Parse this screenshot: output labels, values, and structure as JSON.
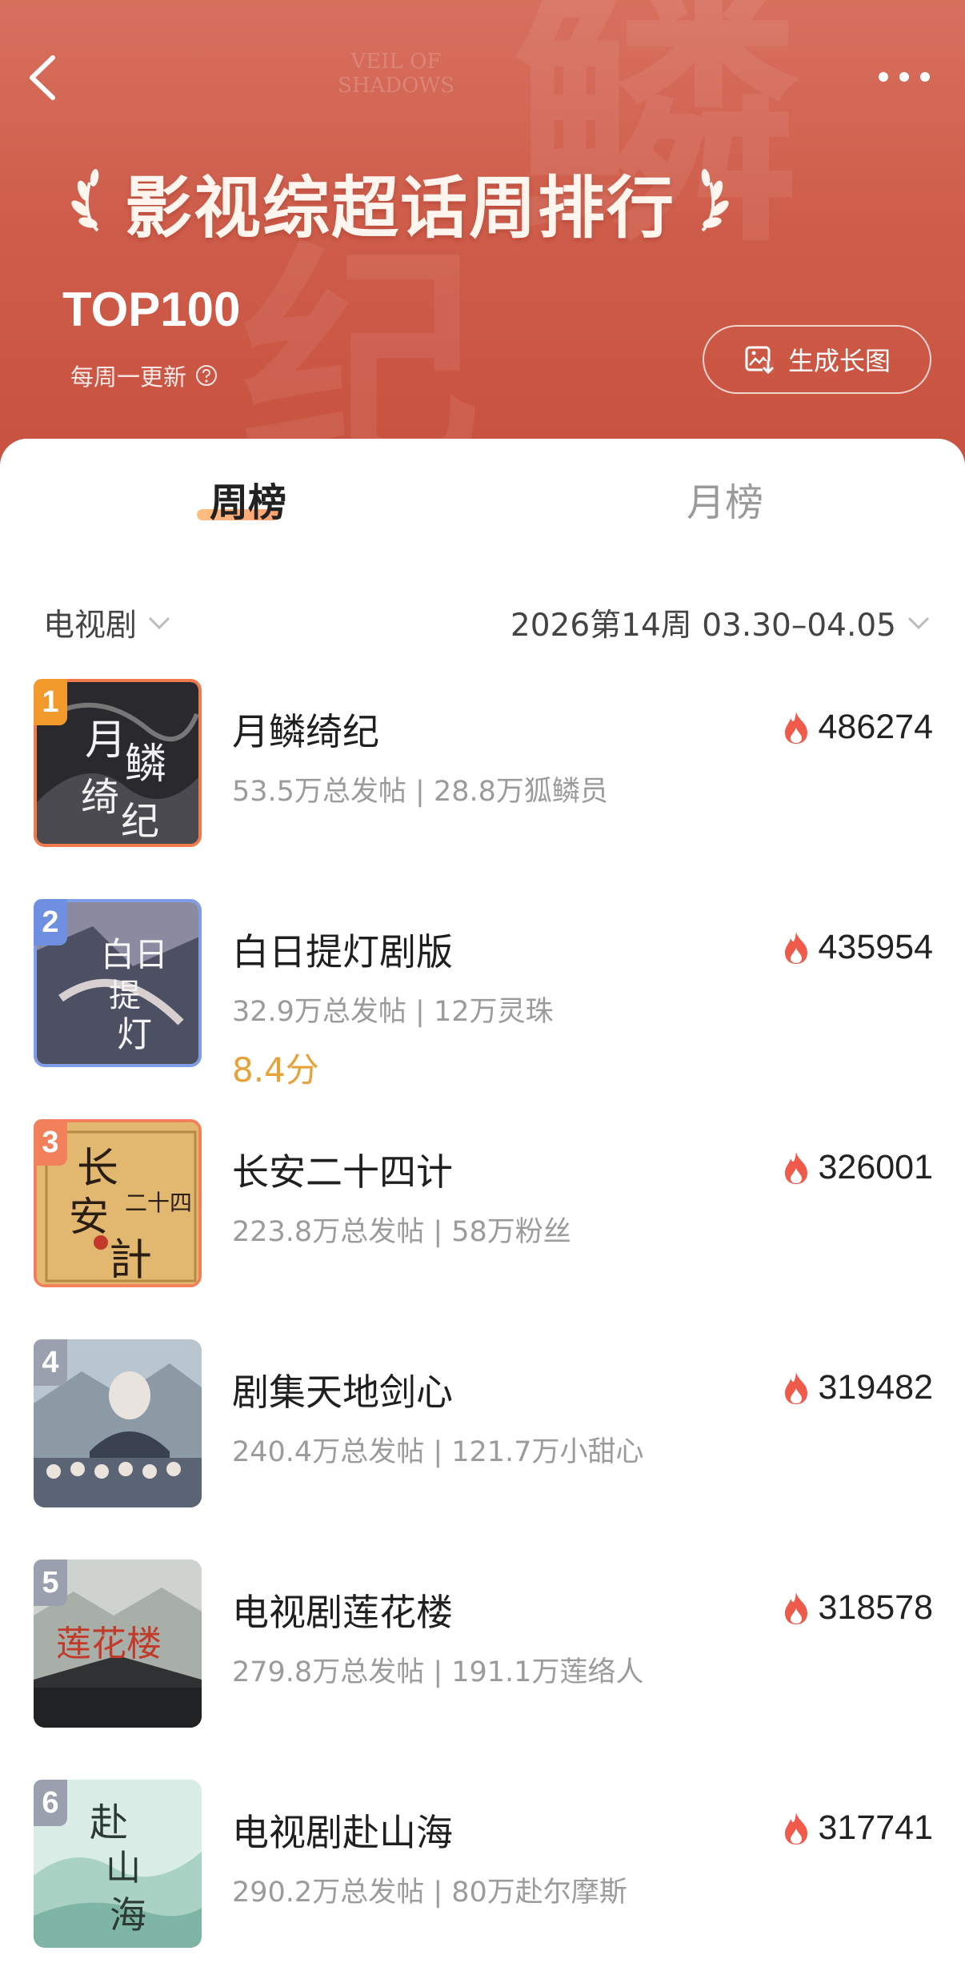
{
  "header": {
    "title": "影视综超话周排行",
    "subtitle": "TOP100",
    "update_note": "每周一更新",
    "generate_button": "生成长图",
    "watermark": "VEIL OF SHADOWS"
  },
  "tabs": [
    {
      "label": "周榜",
      "active": true
    },
    {
      "label": "月榜",
      "active": false
    }
  ],
  "filters": {
    "category": "电视剧",
    "period": "2026第14周 03.30–04.05"
  },
  "colors": {
    "banner": "#cf5d4b",
    "heat_icon": "#ef5a4a",
    "score": "#e8a23b",
    "rank_1": "#f39a2c",
    "rank_2": "#6f8fe0",
    "rank_3": "#f2805a",
    "rank_other": "#9aa0ad"
  },
  "list": [
    {
      "rank": "1",
      "name": "月鳞绮纪",
      "stats": "53.5万总发帖 | 28.8万狐鳞员",
      "heat": "486274",
      "score": ""
    },
    {
      "rank": "2",
      "name": "白日提灯剧版",
      "stats": "32.9万总发帖 | 12万灵珠",
      "heat": "435954",
      "score": "8.4分"
    },
    {
      "rank": "3",
      "name": "长安二十四计",
      "stats": "223.8万总发帖 | 58万粉丝",
      "heat": "326001",
      "score": ""
    },
    {
      "rank": "4",
      "name": "剧集天地剑心",
      "stats": "240.4万总发帖 | 121.7万小甜心",
      "heat": "319482",
      "score": ""
    },
    {
      "rank": "5",
      "name": "电视剧莲花楼",
      "stats": "279.8万总发帖 | 191.1万莲络人",
      "heat": "318578",
      "score": ""
    },
    {
      "rank": "6",
      "name": "电视剧赴山海",
      "stats": "290.2万总发帖 | 80万赴尔摩斯",
      "heat": "317741",
      "score": ""
    }
  ]
}
